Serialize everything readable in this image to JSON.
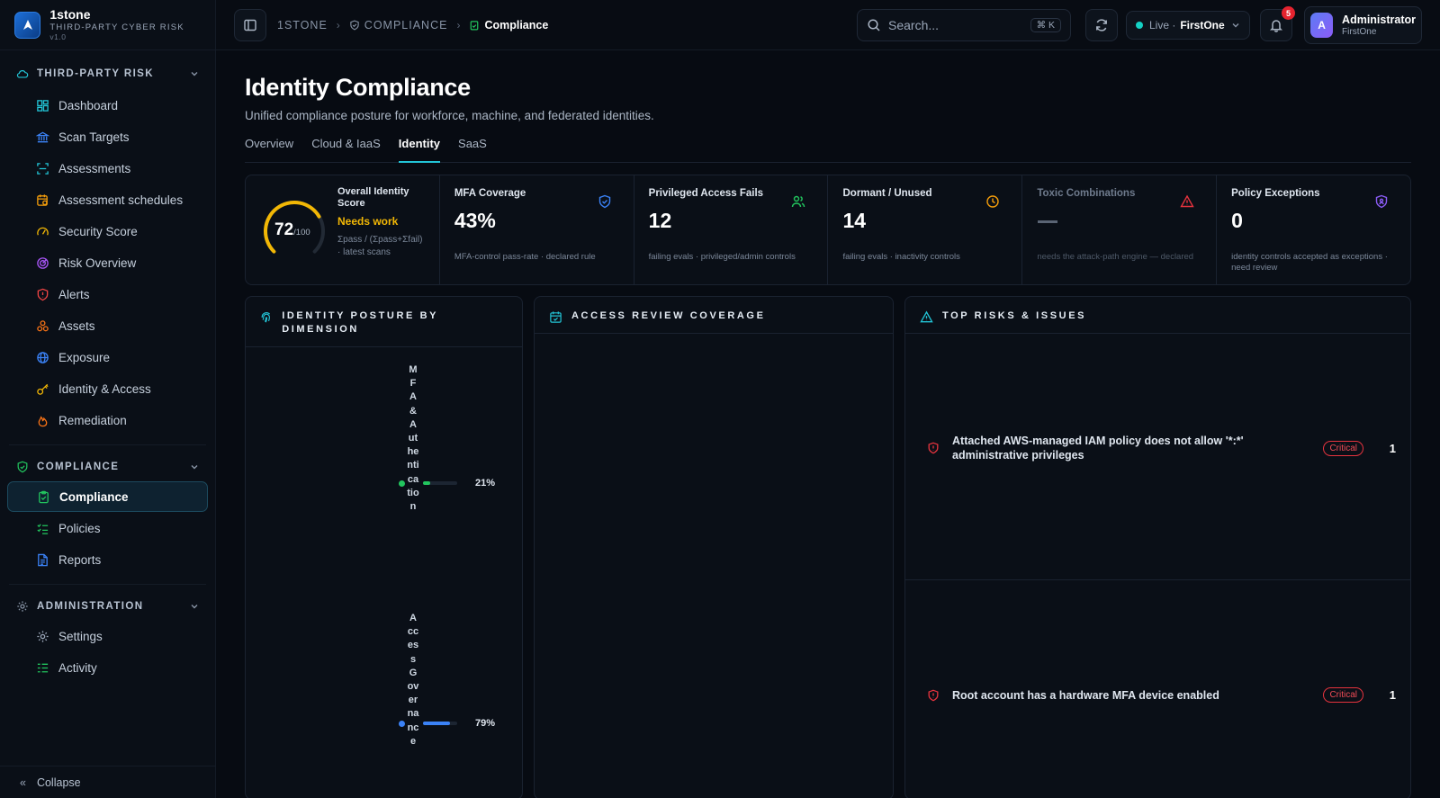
{
  "brand": {
    "name": "1stone",
    "subtitle": "THIRD-PARTY CYBER RISK",
    "version": "v1.0"
  },
  "sidebar": {
    "sections": [
      {
        "label": "THIRD-PARTY RISK",
        "items": [
          {
            "label": "Dashboard",
            "icon": "dashboard-icon"
          },
          {
            "label": "Scan Targets",
            "icon": "bank-icon"
          },
          {
            "label": "Assessments",
            "icon": "scan-icon"
          },
          {
            "label": "Assessment schedules",
            "icon": "calendar-clock-icon"
          },
          {
            "label": "Security Score",
            "icon": "gauge-icon"
          },
          {
            "label": "Risk Overview",
            "icon": "radar-icon"
          },
          {
            "label": "Alerts",
            "icon": "shield-alert-icon"
          },
          {
            "label": "Assets",
            "icon": "boxes-icon"
          },
          {
            "label": "Exposure",
            "icon": "globe-icon"
          },
          {
            "label": "Identity & Access",
            "icon": "key-icon"
          },
          {
            "label": "Remediation",
            "icon": "flame-icon"
          }
        ]
      },
      {
        "label": "COMPLIANCE",
        "items": [
          {
            "label": "Compliance",
            "icon": "clipboard-check-icon",
            "active": true
          },
          {
            "label": "Policies",
            "icon": "list-checks-icon"
          },
          {
            "label": "Reports",
            "icon": "file-text-icon"
          }
        ]
      },
      {
        "label": "ADMINISTRATION",
        "items": [
          {
            "label": "Settings",
            "icon": "gear-icon"
          },
          {
            "label": "Activity",
            "icon": "activity-list-icon"
          }
        ]
      }
    ],
    "collapse_label": "Collapse"
  },
  "topbar": {
    "breadcrumbs": [
      "1STONE",
      "COMPLIANCE",
      "Compliance"
    ],
    "search_placeholder": "Search...",
    "search_shortcut": "⌘ K",
    "env_live": "Live ·",
    "env_name": "FirstOne",
    "notifications_count": "5",
    "user_initial": "A",
    "user_name": "Administrator",
    "user_org": "FirstOne"
  },
  "page": {
    "title": "Identity Compliance",
    "subtitle": "Unified compliance posture for workforce, machine, and federated identities.",
    "tabs": [
      "Overview",
      "Cloud & IaaS",
      "Identity",
      "SaaS"
    ],
    "active_tab": "Identity"
  },
  "kpis": {
    "overall": {
      "title": "Overall Identity Score",
      "score": "72",
      "max": "/100",
      "score_value": 72,
      "status": "Needs work",
      "note": "Σpass / (Σpass+Σfail) · latest scans",
      "color": "#f2b705"
    },
    "cards": [
      {
        "title": "MFA Coverage",
        "value": "43%",
        "note": "MFA-control pass-rate · declared rule",
        "icon": "shield-check-icon",
        "color": "#3b82f6"
      },
      {
        "title": "Privileged Access Fails",
        "value": "12",
        "note": "failing evals · privileged/admin controls",
        "icon": "users-icon",
        "color": "#22c55e"
      },
      {
        "title": "Dormant / Unused",
        "value": "14",
        "note": "failing evals · inactivity controls",
        "icon": "clock-icon",
        "color": "#f59e0b"
      },
      {
        "title": "Toxic Combinations",
        "value": "",
        "note": "needs the attack-path engine — declared",
        "icon": "warning-triangle-icon",
        "color": "#e5333e",
        "dim": true
      },
      {
        "title": "Policy Exceptions",
        "value": "0",
        "note": "identity controls accepted as exceptions · need review",
        "icon": "shield-user-icon",
        "color": "#8b5cf6"
      }
    ]
  },
  "panels": {
    "posture": {
      "title": "IDENTITY POSTURE BY DIMENSION",
      "dimensions": [
        {
          "label": "MFA & Authentication",
          "pct_label": "21%",
          "value": 0.21,
          "color": "#22c55e"
        },
        {
          "label": "Access Governance",
          "pct_label": "79%",
          "value": 0.79,
          "color": "#3b82f6"
        }
      ]
    },
    "access_review": {
      "title": "ACCESS REVIEW COVERAGE"
    },
    "risks": {
      "title": "TOP RISKS & ISSUES",
      "items": [
        {
          "text": "Attached AWS-managed IAM policy does not allow '*:*' administrative privileges",
          "severity": "Critical",
          "count": "1"
        },
        {
          "text": "Root account has a hardware MFA device enabled",
          "severity": "Critical",
          "count": "1"
        }
      ]
    }
  },
  "colors": {
    "accent": "#22c4d6",
    "critical": "#e5333e",
    "warning": "#f2b705"
  }
}
